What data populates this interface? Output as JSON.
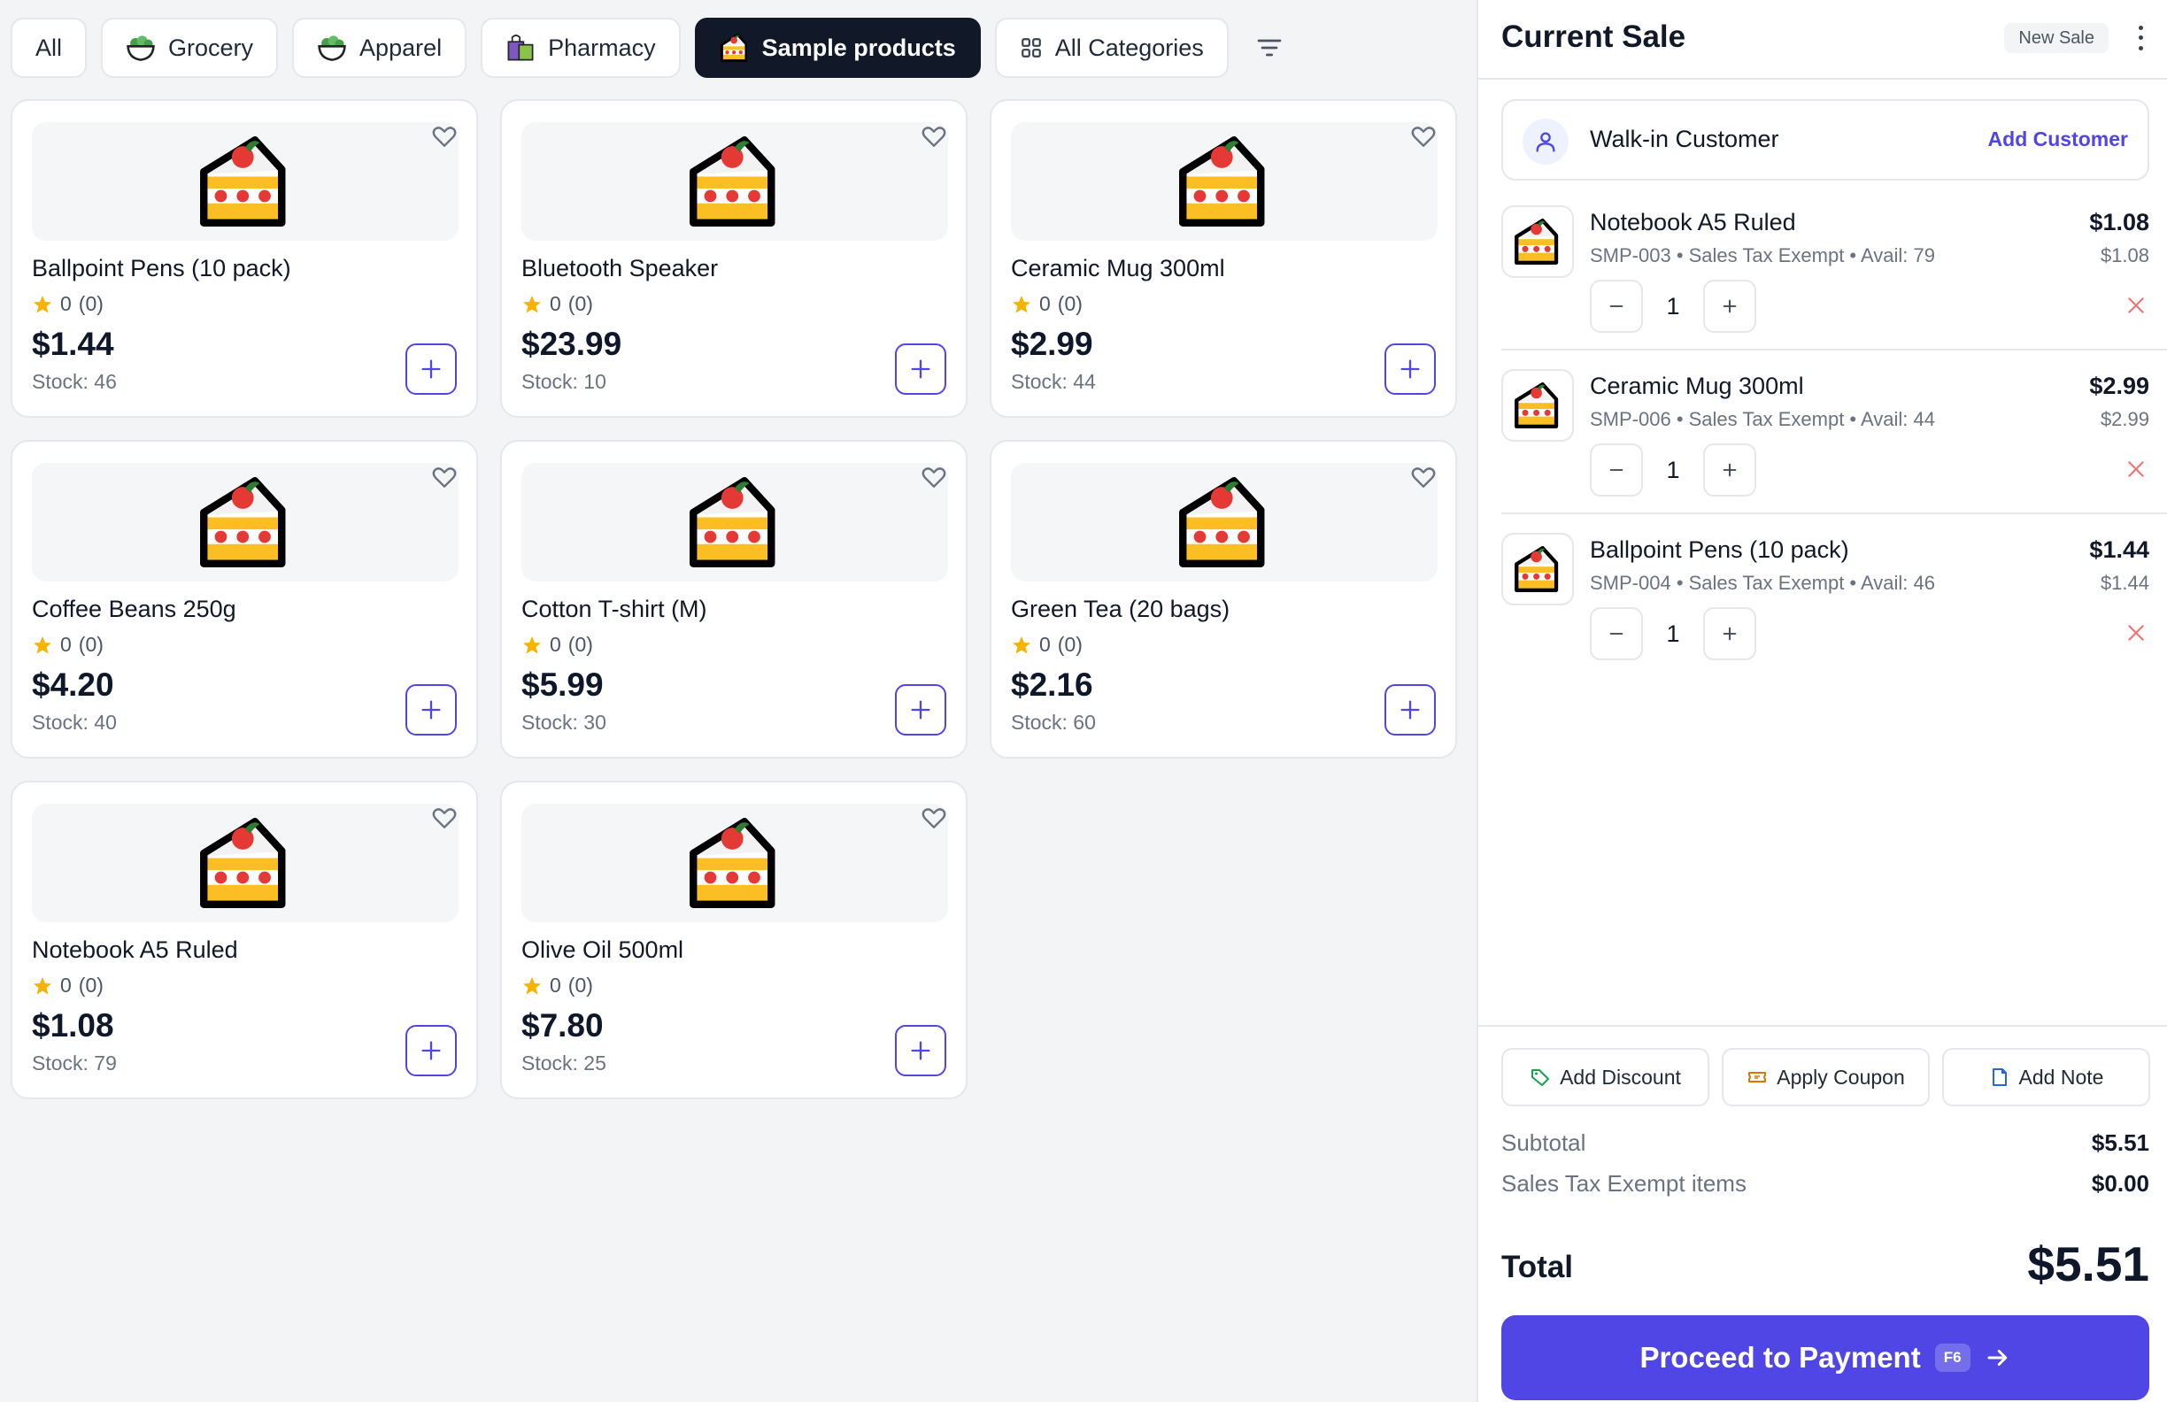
{
  "categories": [
    {
      "label": "All",
      "icon": null,
      "active": false
    },
    {
      "label": "Grocery",
      "icon": "salad-bowl-icon",
      "active": false
    },
    {
      "label": "Apparel",
      "icon": "salad-bowl-icon",
      "active": false
    },
    {
      "label": "Pharmacy",
      "icon": "shopping-bags-icon",
      "active": false
    },
    {
      "label": "Sample products",
      "icon": "cake-slice-icon",
      "active": true
    },
    {
      "label": "All Categories",
      "icon": "grid-icon",
      "active": false
    }
  ],
  "products": [
    {
      "name": "Ballpoint Pens (10 pack)",
      "rating": "0",
      "reviews": "(0)",
      "price": "$1.44",
      "stock": "Stock: 46"
    },
    {
      "name": "Bluetooth Speaker",
      "rating": "0",
      "reviews": "(0)",
      "price": "$23.99",
      "stock": "Stock: 10"
    },
    {
      "name": "Ceramic Mug 300ml",
      "rating": "0",
      "reviews": "(0)",
      "price": "$2.99",
      "stock": "Stock: 44"
    },
    {
      "name": "Coffee Beans 250g",
      "rating": "0",
      "reviews": "(0)",
      "price": "$4.20",
      "stock": "Stock: 40"
    },
    {
      "name": "Cotton T-shirt (M)",
      "rating": "0",
      "reviews": "(0)",
      "price": "$5.99",
      "stock": "Stock: 30"
    },
    {
      "name": "Green Tea (20 bags)",
      "rating": "0",
      "reviews": "(0)",
      "price": "$2.16",
      "stock": "Stock: 60"
    },
    {
      "name": "Notebook A5 Ruled",
      "rating": "0",
      "reviews": "(0)",
      "price": "$1.08",
      "stock": "Stock: 79"
    },
    {
      "name": "Olive Oil 500ml",
      "rating": "0",
      "reviews": "(0)",
      "price": "$7.80",
      "stock": "Stock: 25"
    }
  ],
  "sale": {
    "title": "Current Sale",
    "new_sale_label": "New Sale",
    "customer_name": "Walk-in Customer",
    "add_customer_label": "Add Customer",
    "items": [
      {
        "name": "Notebook A5 Ruled",
        "meta": "SMP-003 • Sales Tax Exempt • Avail: 79",
        "total": "$1.08",
        "unit": "$1.08",
        "qty": "1"
      },
      {
        "name": "Ceramic Mug 300ml",
        "meta": "SMP-006 • Sales Tax Exempt • Avail: 44",
        "total": "$2.99",
        "unit": "$2.99",
        "qty": "1"
      },
      {
        "name": "Ballpoint Pens (10 pack)",
        "meta": "SMP-004 • Sales Tax Exempt • Avail: 46",
        "total": "$1.44",
        "unit": "$1.44",
        "qty": "1"
      }
    ],
    "actions": {
      "discount": "Add Discount",
      "coupon": "Apply Coupon",
      "note": "Add Note"
    },
    "subtotal_label": "Subtotal",
    "subtotal_value": "$5.51",
    "tax_label": "Sales Tax Exempt items",
    "tax_value": "$0.00",
    "total_label": "Total",
    "total_value": "$5.51",
    "pay_label": "Proceed to Payment",
    "pay_shortcut": "F6"
  },
  "colors": {
    "accent": "#4f46e5",
    "active_tab": "#111827",
    "star": "#f5b400",
    "remove": "#ef4444"
  }
}
